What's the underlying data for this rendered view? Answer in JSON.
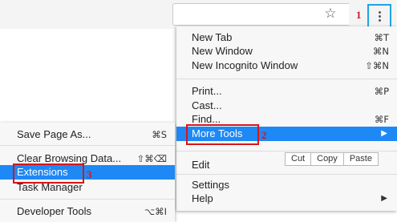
{
  "toolbar": {
    "star_icon": "star-outline-icon",
    "menu_icon": "three-dots-vertical-icon",
    "menu_button_color": "#1fa4df"
  },
  "annotations": {
    "step1": "1",
    "step2": "2",
    "step3": "3",
    "color": "#d8151a"
  },
  "main_menu": {
    "new_tab": {
      "label": "New Tab",
      "shortcut": "⌘T"
    },
    "new_window": {
      "label": "New Window",
      "shortcut": "⌘N"
    },
    "new_incognito": {
      "label": "New Incognito Window",
      "shortcut": "⇧⌘N"
    },
    "print": {
      "label": "Print...",
      "shortcut": "⌘P"
    },
    "cast": {
      "label": "Cast..."
    },
    "find": {
      "label": "Find...",
      "shortcut": "⌘F"
    },
    "more_tools": {
      "label": "More Tools",
      "arrow": "▶"
    },
    "edit": {
      "label": "Edit",
      "cut": "Cut",
      "copy": "Copy",
      "paste": "Paste"
    },
    "settings": {
      "label": "Settings"
    },
    "help": {
      "label": "Help",
      "arrow": "▶"
    },
    "highlight_color": "#1e88f5"
  },
  "sub_menu": {
    "save_page": {
      "label": "Save Page As...",
      "shortcut": "⌘S"
    },
    "clear_browsing": {
      "label": "Clear Browsing Data...",
      "shortcut": "⇧⌘⌫"
    },
    "extensions": {
      "label": "Extensions"
    },
    "task_manager": {
      "label": "Task Manager"
    },
    "developer_tools": {
      "label": "Developer Tools",
      "shortcut": "⌥⌘I"
    }
  }
}
